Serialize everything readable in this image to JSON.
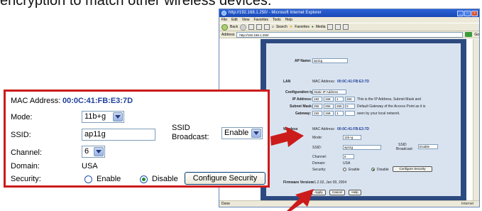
{
  "instruction_text": "encryption to match other wireless devices.",
  "browser": {
    "title": "http://192.168.1.250/ - Microsoft Internet Explorer",
    "menu": [
      "File",
      "Edit",
      "View",
      "Favorites",
      "Tools",
      "Help"
    ],
    "toolbar": {
      "back": "Back",
      "search": "Search",
      "favorites": "Favorites",
      "media": "Media"
    },
    "address_label": "Address",
    "address_value": "http://192.168.1.250/",
    "go_label": "Go",
    "status_left": "Done",
    "status_right": "Internet"
  },
  "page": {
    "ap_name_label": "AP Name:",
    "ap_name_value": "ap11g",
    "lan_label": "LAN",
    "lan_mac_label": "MAC Address:",
    "lan_mac_value": "00:0C:41:FB:E3:7D",
    "config_type_label": "Configuration type:",
    "config_type_value": "Static IP Address",
    "ip_label": "IP Address:",
    "ip_octets": [
      "192",
      "168",
      "1",
      "250"
    ],
    "ip_note": "This is the IP Address, Subnet Mask and",
    "subnet_label": "Subnet Mask:",
    "subnet_octets": [
      "255",
      "255",
      "255",
      "0"
    ],
    "subnet_note": "Default Gateway of the Access Point as it is",
    "gateway_label": "Gateway:",
    "gateway_octets": [
      "192",
      "168",
      "1",
      ""
    ],
    "gateway_note": "seen by your local network.",
    "wireless_label": "Wireless",
    "wl_mac_label": "MAC Address:",
    "wl_mac_value": "00:0C:41:FB:E3:7D",
    "mode_label": "Mode:",
    "mode_value": "11b+g",
    "ssid_label": "SSID:",
    "ssid_value": "ap11g",
    "ssid_broadcast_label_1": "SSID",
    "ssid_broadcast_label_2": "Broadcast:",
    "ssid_broadcast_value": "Enable",
    "channel_label": "Channel:",
    "channel_value": "6",
    "domain_label": "Domain:",
    "domain_value": "USA",
    "security_label": "Security:",
    "security_enable": "Enable",
    "security_disable": "Disable",
    "configure_security": "Configure Security",
    "firmware_label": "Firmware Version:",
    "firmware_value": "v1.2.02, Jan 09, 2004",
    "apply": "Apply",
    "cancel": "Cancel",
    "help": "Help"
  },
  "callout": {
    "mac_label": "MAC Address:",
    "mac_value": "00:0C:41:FB:E3:7D",
    "mode_label": "Mode:",
    "mode_value": "11b+g",
    "ssid_label": "SSID:",
    "ssid_value": "ap11g",
    "ssid_broadcast_label_1": "SSID",
    "ssid_broadcast_label_2": "Broadcast:",
    "ssid_broadcast_value": "Enable",
    "channel_label": "Channel:",
    "channel_value": "6",
    "domain_label": "Domain:",
    "domain_value": "USA",
    "security_label": "Security:",
    "security_enable": "Enable",
    "security_disable": "Disable",
    "security_selected": "Disable",
    "configure_security": "Configure Security"
  },
  "colors": {
    "highlight_red": "#cc1b1b",
    "mac_blue": "#1f3f9a",
    "panel_blue": "#2d4a80"
  }
}
